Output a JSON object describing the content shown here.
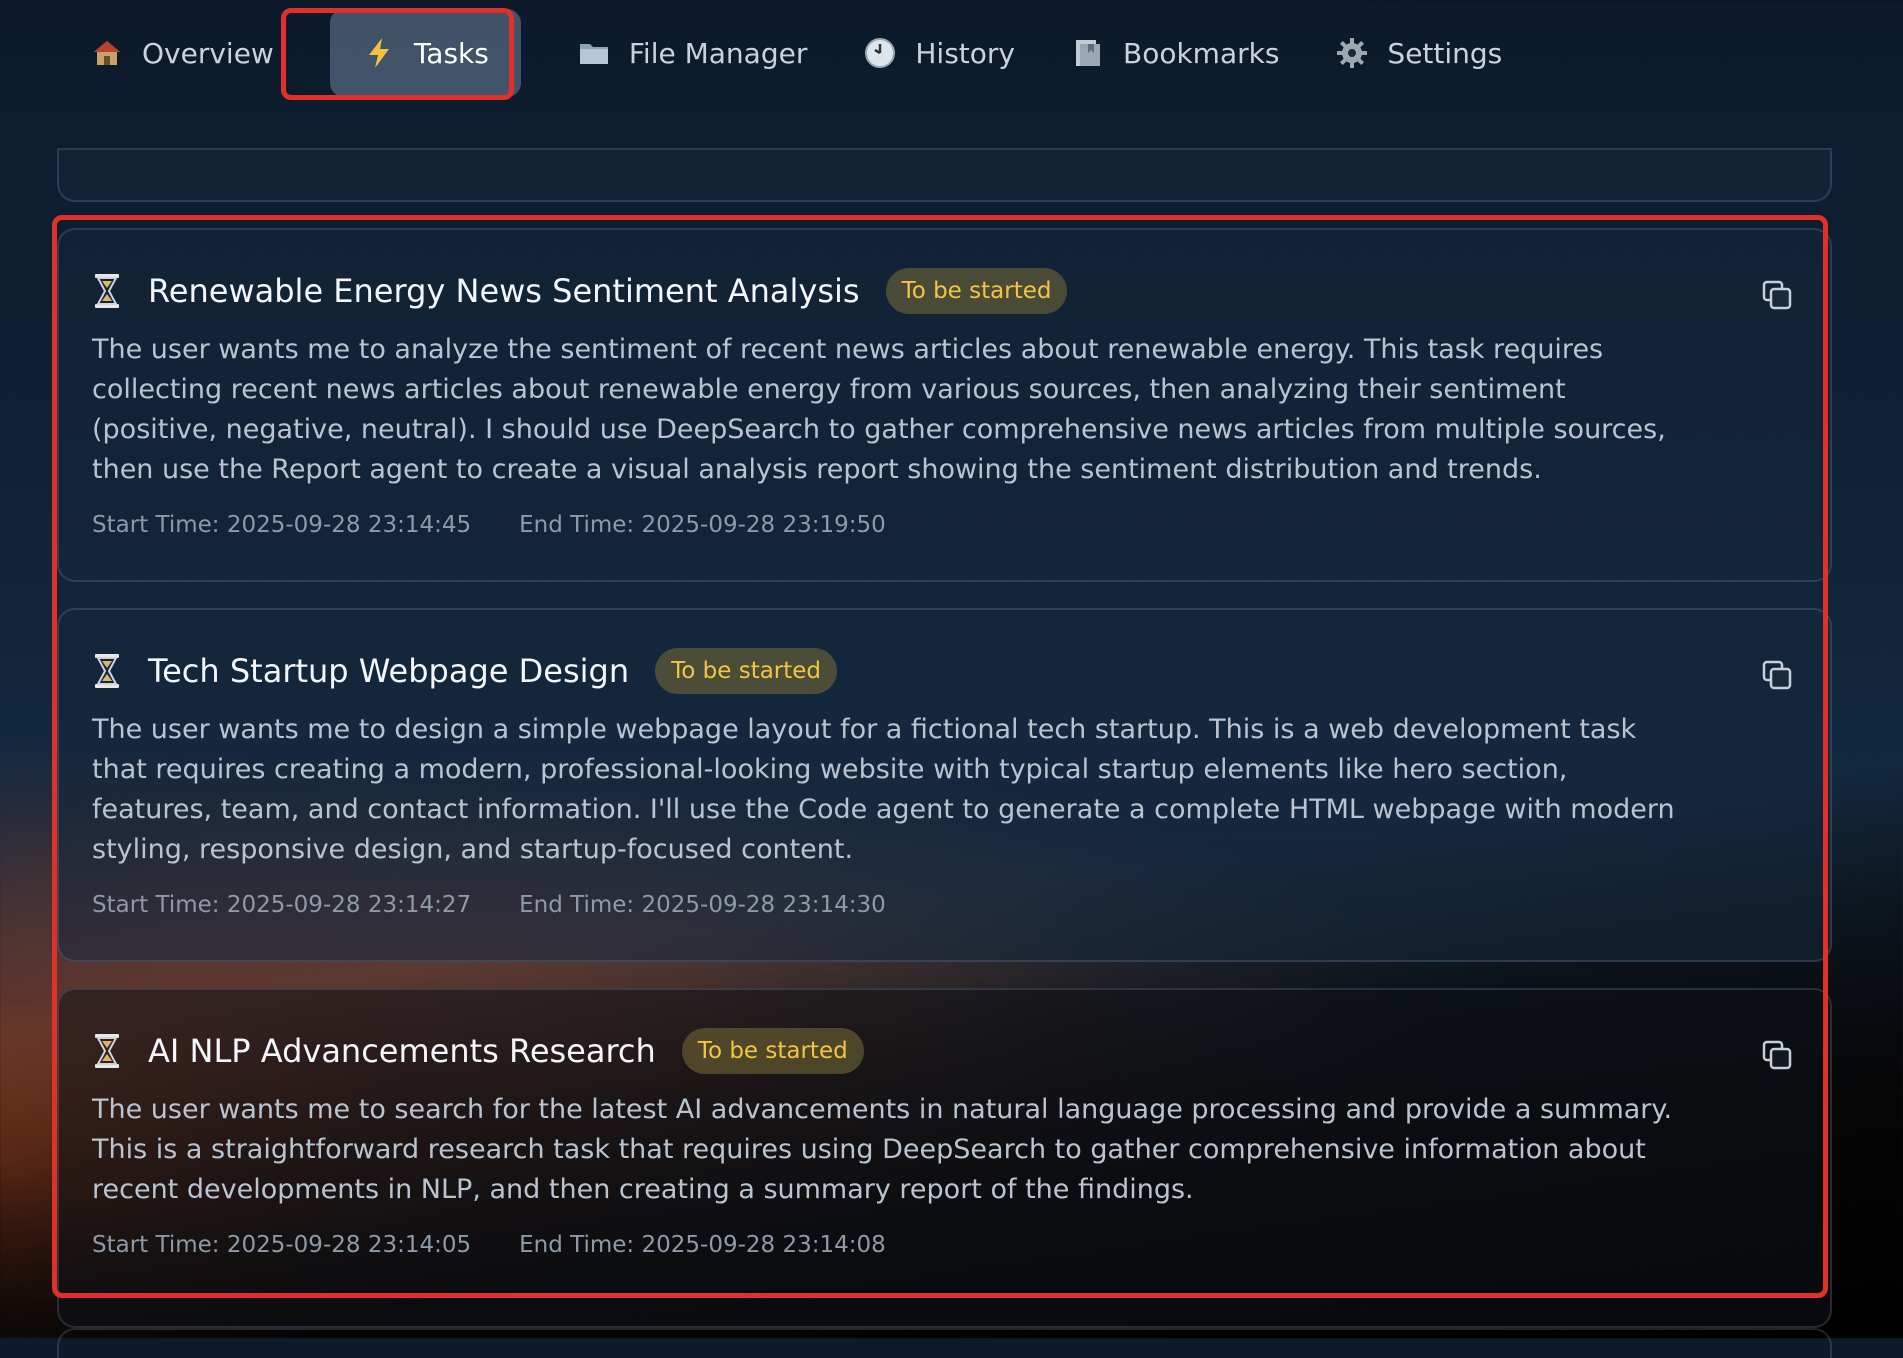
{
  "nav": {
    "items": [
      {
        "label": "Overview",
        "icon": "house-icon"
      },
      {
        "label": "Tasks",
        "icon": "lightning-icon",
        "active": true
      },
      {
        "label": "File Manager",
        "icon": "folder-icon"
      },
      {
        "label": "History",
        "icon": "clock-icon"
      },
      {
        "label": "Bookmarks",
        "icon": "bookmark-icon"
      },
      {
        "label": "Settings",
        "icon": "gear-icon"
      }
    ]
  },
  "colors": {
    "accent_outline": "#e1302a",
    "status_text": "#f4c542"
  },
  "tasks": [
    {
      "title": "Renewable Energy News Sentiment Analysis",
      "status": "To be started",
      "description": "The user wants me to analyze the sentiment of recent news articles about renewable energy. This task requires collecting recent news articles about renewable energy from various sources, then analyzing their sentiment (positive, negative, neutral). I should use DeepSearch to gather comprehensive news articles from multiple sources, then use the Report agent to create a visual analysis report showing the sentiment distribution and trends.",
      "start_time": "Start Time: 2025-09-28 23:14:45",
      "end_time": "End Time: 2025-09-28 23:19:50"
    },
    {
      "title": "Tech Startup Webpage Design",
      "status": "To be started",
      "description": "The user wants me to design a simple webpage layout for a fictional tech startup. This is a web development task that requires creating a modern, professional-looking website with typical startup elements like hero section, features, team, and contact information. I'll use the Code agent to generate a complete HTML webpage with modern styling, responsive design, and startup-focused content.",
      "start_time": "Start Time: 2025-09-28 23:14:27",
      "end_time": "End Time: 2025-09-28 23:14:30"
    },
    {
      "title": "AI NLP Advancements Research",
      "status": "To be started",
      "description": "The user wants me to search for the latest AI advancements in natural language processing and provide a summary. This is a straightforward research task that requires using DeepSearch to gather comprehensive information about recent developments in NLP, and then creating a summary report of the findings.",
      "start_time": "Start Time: 2025-09-28 23:14:05",
      "end_time": "End Time: 2025-09-28 23:14:08"
    }
  ]
}
